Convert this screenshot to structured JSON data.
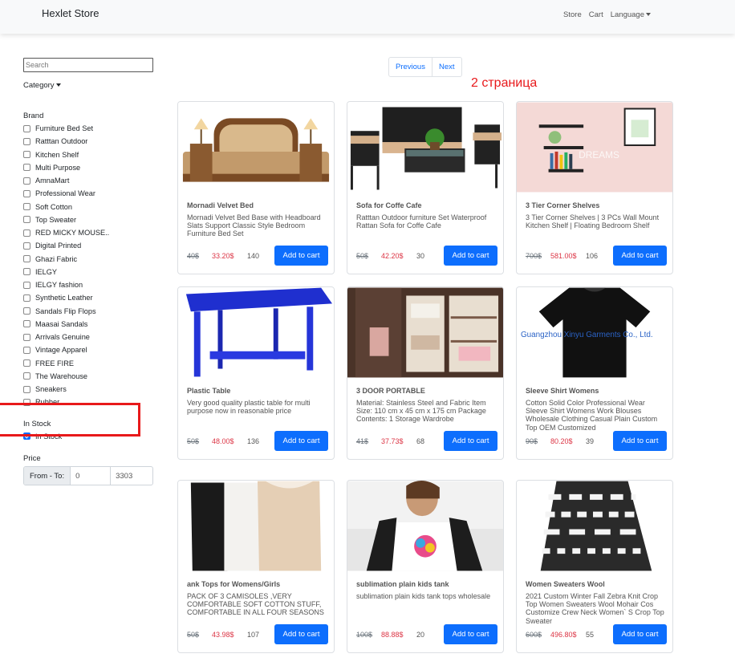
{
  "navbar": {
    "brand": "Hexlet Store",
    "links": [
      "Store",
      "Cart",
      "Language"
    ]
  },
  "sidebar": {
    "search_placeholder": "Search",
    "category_label": "Category",
    "brand_title": "Brand",
    "brands": [
      "Furniture Bed Set",
      "Ratttan Outdoor",
      "Kitchen Shelf",
      "Multi Purpose",
      "AmnaMart",
      "Professional Wear",
      "Soft Cotton",
      "Top Sweater",
      "RED MICKY MOUSE..",
      "Digital Printed",
      "Ghazi Fabric",
      "IELGY",
      "IELGY fashion",
      "Synthetic Leather",
      "Sandals Flip Flops",
      "Maasai Sandals",
      "Arrivals Genuine",
      "Vintage Apparel",
      "FREE FIRE",
      "The Warehouse",
      "Sneakers",
      "Rubber"
    ],
    "instock_title": "In Stock",
    "instock_label": "In Stock",
    "instock_checked": true,
    "price_title": "Price",
    "price_label": "From - To:",
    "price_from": "0",
    "price_to": "3303"
  },
  "pagination": {
    "previous": "Previous",
    "next": "Next",
    "note": "2 страница"
  },
  "products": [
    {
      "title": "Mornadi Velvet Bed",
      "description": "Mornadi Velvet Bed Base with Headboard Slats Support Classic Style Bedroom Furniture Bed Set",
      "old_price": "40$",
      "new_price": "33.20$",
      "stock": "140",
      "button": "Add to cart",
      "image": "bed"
    },
    {
      "title": "Sofa for Coffe Cafe",
      "description": "Ratttan Outdoor furniture Set Waterproof Rattan Sofa for Coffe Cafe",
      "old_price": "50$",
      "new_price": "42.20$",
      "stock": "30",
      "button": "Add to cart",
      "image": "sofa"
    },
    {
      "title": "3 Tier Corner Shelves",
      "description": "3 Tier Corner Shelves | 3 PCs Wall Mount Kitchen Shelf | Floating Bedroom Shelf",
      "old_price": "700$",
      "new_price": "581.00$",
      "stock": "106",
      "button": "Add to cart",
      "image": "shelves",
      "watermark": "DREAMS"
    },
    {
      "title": "Plastic Table",
      "description": "Very good quality plastic table for multi purpose now in reasonable price",
      "old_price": "50$",
      "new_price": "48.00$",
      "stock": "136",
      "button": "Add to cart",
      "image": "table"
    },
    {
      "title": "3 DOOR PORTABLE",
      "description": "Material: Stainless Steel and Fabric Item Size: 110 cm x 45 cm x 175 cm Package Contents: 1 Storage Wardrobe",
      "old_price": "41$",
      "new_price": "37.73$",
      "stock": "68",
      "button": "Add to cart",
      "image": "wardrobe"
    },
    {
      "title": "Sleeve Shirt Womens",
      "description": "Cotton Solid Color Professional Wear Sleeve Shirt Womens Work Blouses Wholesale Clothing Casual Plain Custom Top OEM Customized",
      "old_price": "90$",
      "new_price": "80.20$",
      "stock": "39",
      "button": "Add to cart",
      "image": "tshirt",
      "watermark": "Guangzhou Xinyu Garments Co., Ltd."
    },
    {
      "title": "ank Tops for Womens/Girls",
      "description": "PACK OF 3 CAMISOLES ,VERY COMFORTABLE SOFT COTTON STUFF, COMFORTABLE IN ALL FOUR SEASONS",
      "old_price": "50$",
      "new_price": "43.98$",
      "stock": "107",
      "button": "Add to cart",
      "image": "tanktops"
    },
    {
      "title": "sublimation plain kids tank",
      "description": "sublimation plain kids tank tops wholesale",
      "old_price": "100$",
      "new_price": "88.88$",
      "stock": "20",
      "button": "Add to cart",
      "image": "kid"
    },
    {
      "title": "Women Sweaters Wool",
      "description": "2021 Custom Winter Fall Zebra Knit Crop Top Women Sweaters Wool Mohair Cos Customize Crew Neck Women` S Crop Top Sweater",
      "old_price": "600$",
      "new_price": "496.80$",
      "stock": "55",
      "button": "Add to cart",
      "image": "sweater"
    }
  ]
}
